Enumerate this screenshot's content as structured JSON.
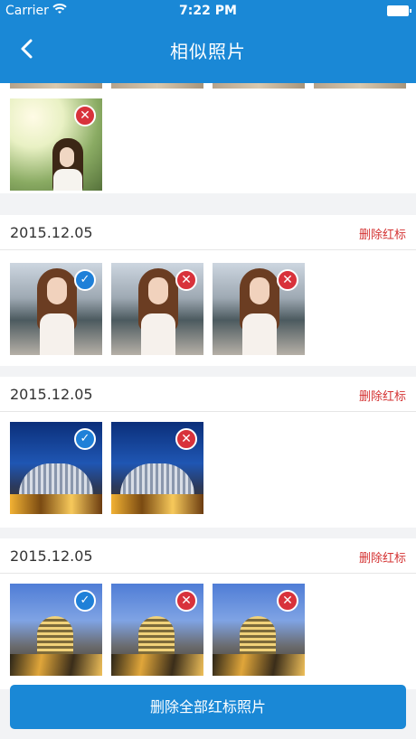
{
  "status_bar": {
    "carrier": "Carrier",
    "time": "7:22 PM"
  },
  "nav": {
    "title": "相似照片",
    "back_icon": "chevron-left-icon"
  },
  "groups": [
    {
      "date": "2015.12.05",
      "action": "删除红标",
      "photos": [
        "selected",
        "marked",
        "marked"
      ]
    },
    {
      "date": "2015.12.05",
      "action": "删除红标",
      "photos": [
        "selected",
        "marked"
      ]
    },
    {
      "date": "2015.12.05",
      "action": "删除红标",
      "photos": [
        "selected",
        "marked",
        "marked"
      ]
    }
  ],
  "bottom_button": {
    "label": "删除全部红标照片"
  },
  "colors": {
    "primary": "#1a88d6",
    "danger": "#d8323b",
    "check": "#1f80d8"
  }
}
